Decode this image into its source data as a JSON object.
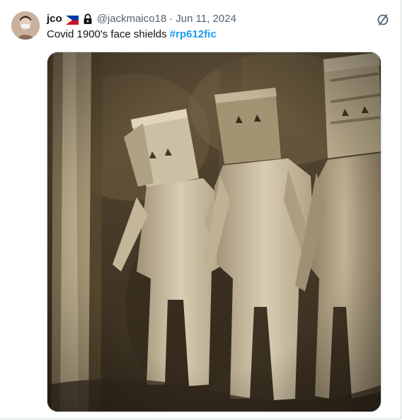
{
  "tweet": {
    "author": {
      "display_name": "jco",
      "handle": "@jackmaico18",
      "flag_icon": "philippines-flag-icon",
      "lock_icon": "lock-icon"
    },
    "separator": "·",
    "date": "Jun 11, 2024",
    "text": "Covid 1900's face shields ",
    "hashtag": "#rp612fic",
    "more_icon": "slashed-circle-icon",
    "media_alt": "Sepia photo of three figures wearing box-shaped head coverings and pale clothing in a forest"
  },
  "colors": {
    "accent": "#1d9bf0",
    "secondary_text": "#536471",
    "primary_text": "#0f1419"
  }
}
